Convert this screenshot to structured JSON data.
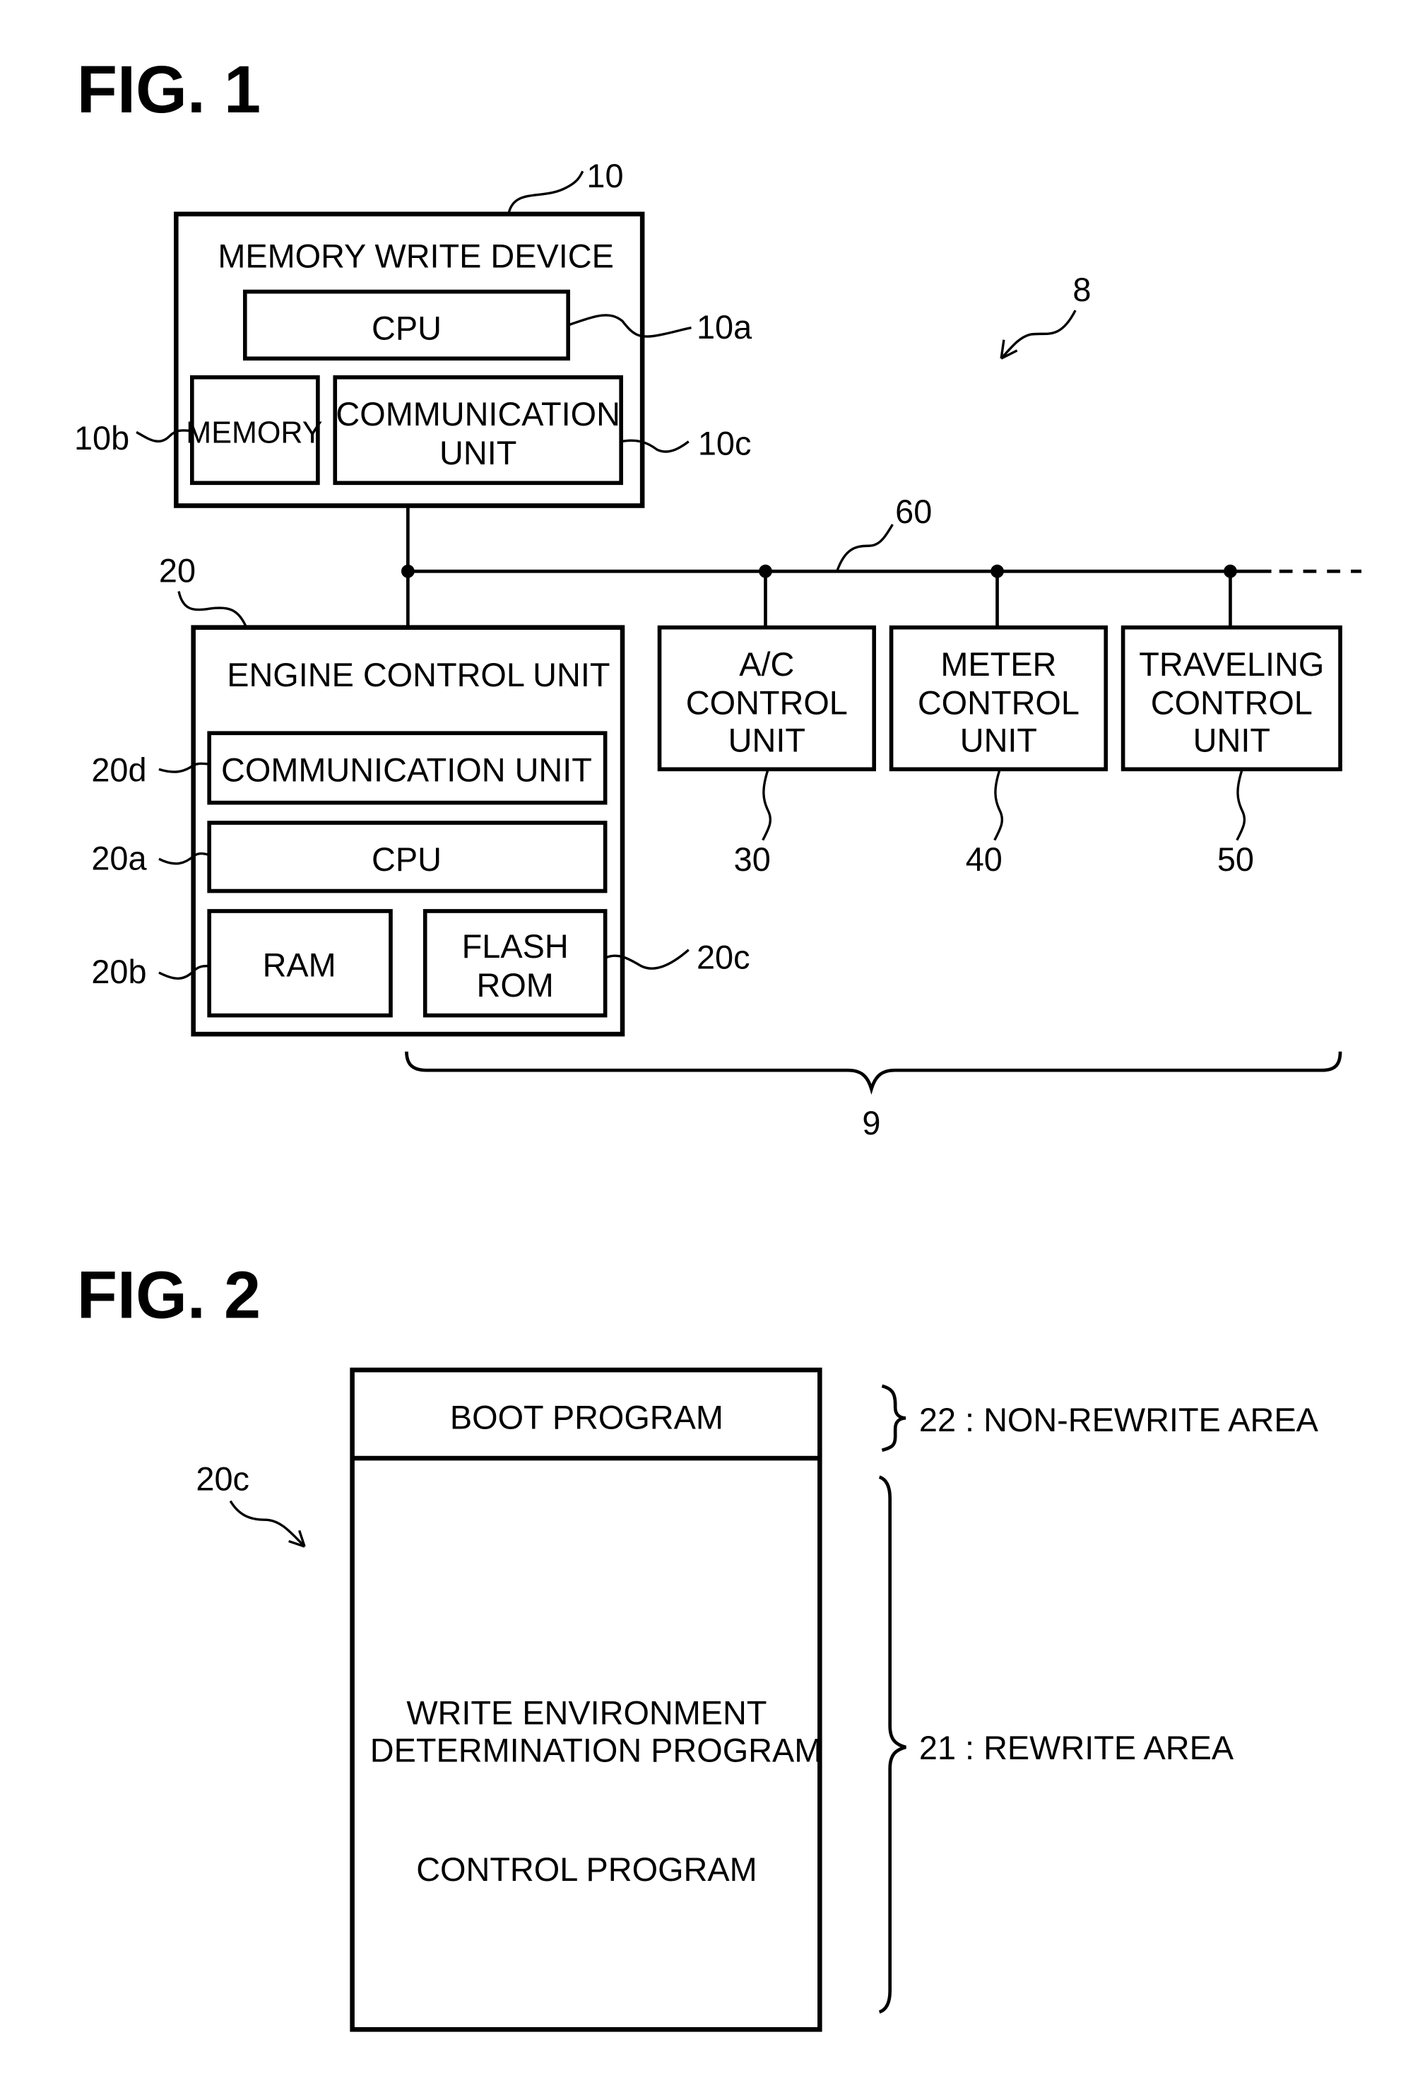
{
  "fig1": {
    "title": "FIG. 1",
    "system_ref": "8",
    "group_ref": "9",
    "bus_ref": "60",
    "memory_write_device": {
      "ref": "10",
      "title": "MEMORY WRITE DEVICE",
      "cpu": {
        "ref": "10a",
        "label": "CPU"
      },
      "memory": {
        "ref": "10b",
        "label": "MEMORY"
      },
      "communication_unit": {
        "ref": "10c",
        "label_line1": "COMMUNICATION",
        "label_line2": "UNIT"
      }
    },
    "engine_control_unit": {
      "ref": "20",
      "title": "ENGINE CONTROL UNIT",
      "communication_unit": {
        "ref": "20d",
        "label": "COMMUNICATION UNIT"
      },
      "cpu": {
        "ref": "20a",
        "label": "CPU"
      },
      "ram": {
        "ref": "20b",
        "label": "RAM"
      },
      "flash_rom": {
        "ref": "20c",
        "label_line1": "FLASH",
        "label_line2": "ROM"
      }
    },
    "control_units": [
      {
        "ref": "30",
        "lines": [
          "A/C",
          "CONTROL",
          "UNIT"
        ]
      },
      {
        "ref": "40",
        "lines": [
          "METER",
          "CONTROL",
          "UNIT"
        ]
      },
      {
        "ref": "50",
        "lines": [
          "TRAVELING",
          "CONTROL",
          "UNIT"
        ]
      }
    ]
  },
  "fig2": {
    "title": "FIG. 2",
    "memory_ref": "20c",
    "boot_program": "BOOT PROGRAM",
    "write_env_line1": "WRITE ENVIRONMENT",
    "write_env_line2": "DETERMINATION PROGRAM",
    "control_program": "CONTROL PROGRAM",
    "non_rewrite_area": "22 : NON-REWRITE AREA",
    "rewrite_area": "21 : REWRITE AREA"
  }
}
